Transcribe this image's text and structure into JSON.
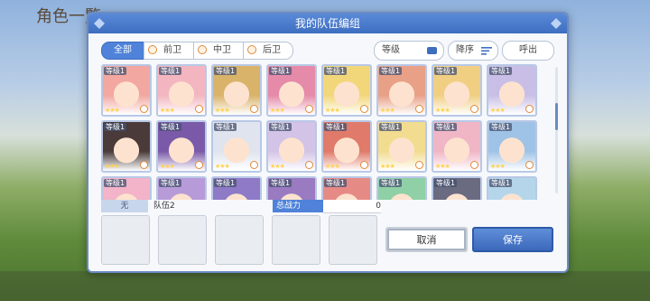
{
  "background": {
    "hud_text": "角色一覧"
  },
  "modal": {
    "title": "我的队伍编组"
  },
  "tabs": [
    {
      "label": "全部",
      "active": true
    },
    {
      "label": "前卫",
      "active": false
    },
    {
      "label": "中卫",
      "active": false
    },
    {
      "label": "后卫",
      "active": false
    }
  ],
  "controls": {
    "sort_field": "等级",
    "order": "降序",
    "summon": "呼出"
  },
  "card_level": "等级1",
  "roster_rows": [
    [
      {
        "stars": "★★★",
        "color": "#f2a7a0"
      },
      {
        "stars": "★★★",
        "color": "#f3b6c0"
      },
      {
        "stars": "★★★",
        "color": "#d9b36a"
      },
      {
        "stars": "★★★",
        "color": "#e58aa8"
      },
      {
        "stars": "★★★",
        "color": "#f2d77a"
      },
      {
        "stars": "★★★",
        "color": "#e8a087"
      },
      {
        "stars": "★★★",
        "color": "#f0cf82"
      },
      {
        "stars": "★★★",
        "color": "#c9bfe6"
      }
    ],
    [
      {
        "stars": "★★★",
        "color": "#4a3a3a"
      },
      {
        "stars": "★★★",
        "color": "#7a5aa8"
      },
      {
        "stars": "★★★",
        "color": "#dfe4ee"
      },
      {
        "stars": "★★★",
        "color": "#d3c3e6"
      },
      {
        "stars": "★★★",
        "color": "#e07a6a"
      },
      {
        "stars": "★★★",
        "color": "#f2dc90"
      },
      {
        "stars": "★★★",
        "color": "#f0b6c6"
      },
      {
        "stars": "★★★",
        "color": "#9fc3e6"
      }
    ],
    [
      {
        "stars": "",
        "color": "#f3b3c8"
      },
      {
        "stars": "",
        "color": "#b79ad8"
      },
      {
        "stars": "",
        "color": "#8e7ac6"
      },
      {
        "stars": "",
        "color": "#9a7ac0"
      },
      {
        "stars": "",
        "color": "#e68a86"
      },
      {
        "stars": "",
        "color": "#8fd0a6"
      },
      {
        "stars": "",
        "color": "#6a6a80"
      },
      {
        "stars": "",
        "color": "#b5d6ea"
      }
    ]
  ],
  "team": {
    "left_label": "无",
    "name": "队伍2",
    "power_label": "总战力",
    "power_value": "0"
  },
  "buttons": {
    "cancel": "取消",
    "save": "保存"
  },
  "colors": {
    "accent": "#4f82d8",
    "title_bar": "#3d6ec0",
    "rank_ring": "#e08a3a"
  }
}
